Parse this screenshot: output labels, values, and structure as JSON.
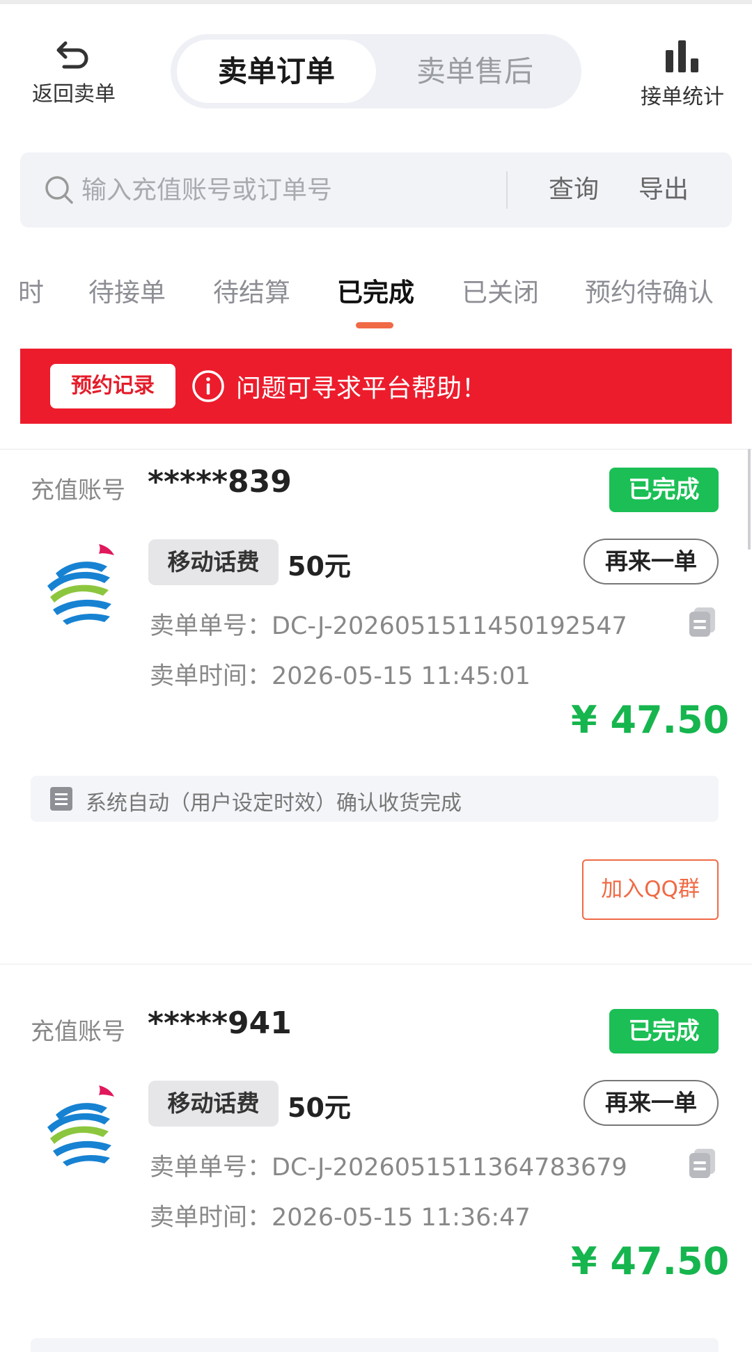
{
  "header": {
    "back_label": "返回卖单",
    "segments": [
      "卖单订单",
      "卖单售后"
    ],
    "stats_label": "接单统计"
  },
  "search": {
    "placeholder": "输入充值账号或订单号",
    "query_label": "查询",
    "export_label": "导出"
  },
  "tabs": [
    "时",
    "待接单",
    "待结算",
    "已完成",
    "已关闭",
    "预约待确认"
  ],
  "active_tab": "已完成",
  "notice": {
    "record_label": "预约记录",
    "message": "问题可寻求平台帮助！"
  },
  "orders": [
    {
      "account_label": "充值账号",
      "account": "*****839",
      "status": "已完成",
      "product": "移动话费",
      "amount": "50元",
      "reorder_label": "再来一单",
      "order_no_label": "卖单单号：",
      "order_no": "DC-J-20260515114501925​47",
      "time_label": "卖单时间：",
      "time": "2026-05-15 11:45:01",
      "price": "¥ 47.50",
      "tip": "系统自动（用户设定时效）确认收货完成",
      "qq_label": "加入QQ群"
    },
    {
      "account_label": "充值账号",
      "account": "*****941",
      "status": "已完成",
      "product": "移动话费",
      "amount": "50元",
      "reorder_label": "再来一单",
      "order_no_label": "卖单单号：",
      "order_no": "DC-J-20260515113647836​79",
      "time_label": "卖单时间：",
      "time": "2026-05-15 11:36:47",
      "price": "¥ 47.50"
    }
  ],
  "colors": {
    "accent": "#f06a45",
    "notice_bg": "#ec1c2c",
    "status_green": "#1bbf55",
    "price_green": "#16b54e"
  }
}
